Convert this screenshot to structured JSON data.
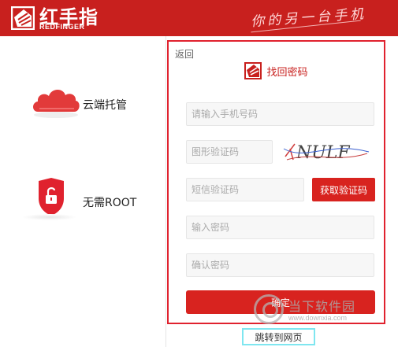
{
  "header": {
    "logo_cn": "红手指",
    "logo_en": "REDFINGER",
    "slogan": "你的另一台手机",
    "logo_icon": "redfinger-logo-icon",
    "background_color": "#c8201e"
  },
  "features": [
    {
      "label": "云端托管",
      "icon": "cloud-icon"
    },
    {
      "label": "无需ROOT",
      "icon": "unlocked-shield-icon"
    }
  ],
  "form": {
    "back_label": "返回",
    "title": "找回密码",
    "title_icon": "redfinger-logo-icon",
    "phone_placeholder": "请输入手机号码",
    "image_code_placeholder": "图形验证码",
    "sms_code_placeholder": "短信验证码",
    "get_code_label": "获取验证码",
    "password_placeholder": "输入密码",
    "confirm_placeholder": "确认密码",
    "submit_label": "确定",
    "border_color": "#e0222e",
    "accent_color": "#d8231f"
  },
  "captcha": {
    "text": "NULF"
  },
  "footer": {
    "jump_link": "跳转到网页"
  },
  "watermark": {
    "text": "当下软件园",
    "url": "www.downxia.com"
  }
}
